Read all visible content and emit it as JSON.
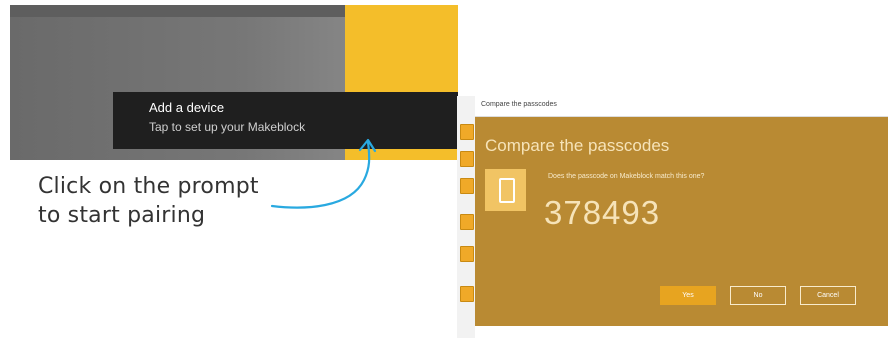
{
  "toast": {
    "title": "Add a device",
    "body": "Tap to set up your Makeblock"
  },
  "caption": {
    "line1": "Click on the prompt",
    "line2": "to start pairing"
  },
  "dialog": {
    "window_title": "Compare the passcodes",
    "heading": "Compare the passcodes",
    "question": "Does the passcode on Makeblock match this one?",
    "passcode": "378493",
    "buttons": {
      "yes": "Yes",
      "no": "No",
      "cancel": "Cancel"
    },
    "device_icon": "phone-icon"
  },
  "colors": {
    "toast_bg": "#1f1f1f",
    "dialog_bg": "#b98a33",
    "accent": "#e7a420",
    "desktop_yellow": "#f4be2a",
    "arrow": "#29a9e0"
  }
}
